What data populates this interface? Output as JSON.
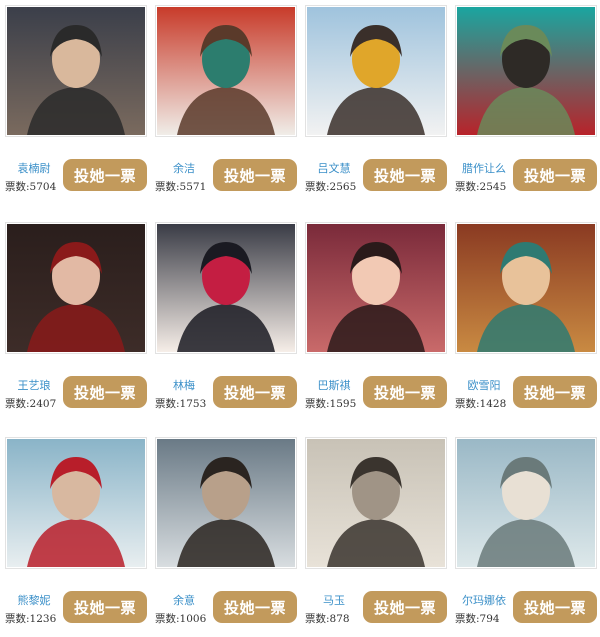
{
  "vote_button_label": "投她一票",
  "votes_prefix": "票数:",
  "accent_color": "#c29a5c",
  "name_color": "#3a8fc8",
  "contestants": [
    {
      "name": "袁楠尉",
      "votes": "5704"
    },
    {
      "name": "余洁",
      "votes": "5571"
    },
    {
      "name": "吕文慧",
      "votes": "2565"
    },
    {
      "name": "腊作让么",
      "votes": "2545"
    },
    {
      "name": "王艺琅",
      "votes": "2407"
    },
    {
      "name": "林梅",
      "votes": "1753"
    },
    {
      "name": "巴斯祺",
      "votes": "1595"
    },
    {
      "name": "欧雪阳",
      "votes": "1428"
    },
    {
      "name": "熊黎妮",
      "votes": "1236"
    },
    {
      "name": "余意",
      "votes": "1006"
    },
    {
      "name": "马玉",
      "votes": "878"
    },
    {
      "name": "尔玛娜依",
      "votes": "794"
    }
  ]
}
